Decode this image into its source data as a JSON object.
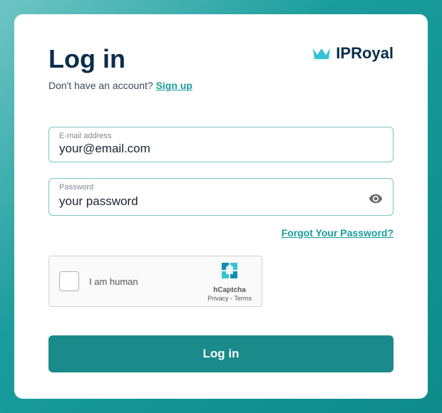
{
  "header": {
    "title": "Log in",
    "logo_text": "IPRoyal",
    "subtitle_prefix": "Don't have an account? ",
    "signup_label": "Sign up"
  },
  "form": {
    "email": {
      "label": "E-mail address",
      "placeholder": "your@email.com"
    },
    "password": {
      "label": "Password",
      "placeholder": "your password"
    },
    "forgot_label": "Forgot Your Password?",
    "submit_label": "Log in"
  },
  "captcha": {
    "label": "I am human",
    "brand": "hCaptcha",
    "privacy": "Privacy",
    "terms": "Terms"
  }
}
